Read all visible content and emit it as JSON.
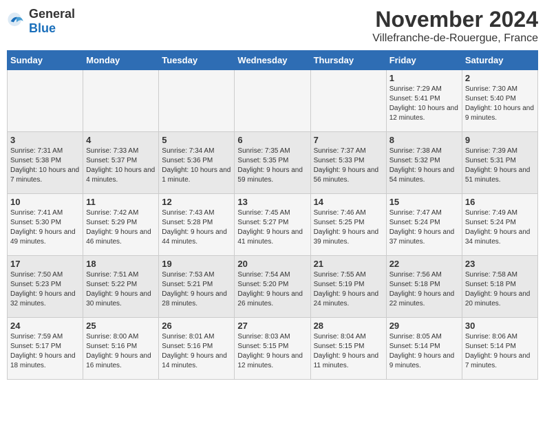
{
  "logo": {
    "general": "General",
    "blue": "Blue"
  },
  "title": "November 2024",
  "subtitle": "Villefranche-de-Rouergue, France",
  "headers": [
    "Sunday",
    "Monday",
    "Tuesday",
    "Wednesday",
    "Thursday",
    "Friday",
    "Saturday"
  ],
  "weeks": [
    [
      {
        "day": "",
        "info": ""
      },
      {
        "day": "",
        "info": ""
      },
      {
        "day": "",
        "info": ""
      },
      {
        "day": "",
        "info": ""
      },
      {
        "day": "",
        "info": ""
      },
      {
        "day": "1",
        "info": "Sunrise: 7:29 AM\nSunset: 5:41 PM\nDaylight: 10 hours and 12 minutes."
      },
      {
        "day": "2",
        "info": "Sunrise: 7:30 AM\nSunset: 5:40 PM\nDaylight: 10 hours and 9 minutes."
      }
    ],
    [
      {
        "day": "3",
        "info": "Sunrise: 7:31 AM\nSunset: 5:38 PM\nDaylight: 10 hours and 7 minutes."
      },
      {
        "day": "4",
        "info": "Sunrise: 7:33 AM\nSunset: 5:37 PM\nDaylight: 10 hours and 4 minutes."
      },
      {
        "day": "5",
        "info": "Sunrise: 7:34 AM\nSunset: 5:36 PM\nDaylight: 10 hours and 1 minute."
      },
      {
        "day": "6",
        "info": "Sunrise: 7:35 AM\nSunset: 5:35 PM\nDaylight: 9 hours and 59 minutes."
      },
      {
        "day": "7",
        "info": "Sunrise: 7:37 AM\nSunset: 5:33 PM\nDaylight: 9 hours and 56 minutes."
      },
      {
        "day": "8",
        "info": "Sunrise: 7:38 AM\nSunset: 5:32 PM\nDaylight: 9 hours and 54 minutes."
      },
      {
        "day": "9",
        "info": "Sunrise: 7:39 AM\nSunset: 5:31 PM\nDaylight: 9 hours and 51 minutes."
      }
    ],
    [
      {
        "day": "10",
        "info": "Sunrise: 7:41 AM\nSunset: 5:30 PM\nDaylight: 9 hours and 49 minutes."
      },
      {
        "day": "11",
        "info": "Sunrise: 7:42 AM\nSunset: 5:29 PM\nDaylight: 9 hours and 46 minutes."
      },
      {
        "day": "12",
        "info": "Sunrise: 7:43 AM\nSunset: 5:28 PM\nDaylight: 9 hours and 44 minutes."
      },
      {
        "day": "13",
        "info": "Sunrise: 7:45 AM\nSunset: 5:27 PM\nDaylight: 9 hours and 41 minutes."
      },
      {
        "day": "14",
        "info": "Sunrise: 7:46 AM\nSunset: 5:25 PM\nDaylight: 9 hours and 39 minutes."
      },
      {
        "day": "15",
        "info": "Sunrise: 7:47 AM\nSunset: 5:24 PM\nDaylight: 9 hours and 37 minutes."
      },
      {
        "day": "16",
        "info": "Sunrise: 7:49 AM\nSunset: 5:24 PM\nDaylight: 9 hours and 34 minutes."
      }
    ],
    [
      {
        "day": "17",
        "info": "Sunrise: 7:50 AM\nSunset: 5:23 PM\nDaylight: 9 hours and 32 minutes."
      },
      {
        "day": "18",
        "info": "Sunrise: 7:51 AM\nSunset: 5:22 PM\nDaylight: 9 hours and 30 minutes."
      },
      {
        "day": "19",
        "info": "Sunrise: 7:53 AM\nSunset: 5:21 PM\nDaylight: 9 hours and 28 minutes."
      },
      {
        "day": "20",
        "info": "Sunrise: 7:54 AM\nSunset: 5:20 PM\nDaylight: 9 hours and 26 minutes."
      },
      {
        "day": "21",
        "info": "Sunrise: 7:55 AM\nSunset: 5:19 PM\nDaylight: 9 hours and 24 minutes."
      },
      {
        "day": "22",
        "info": "Sunrise: 7:56 AM\nSunset: 5:18 PM\nDaylight: 9 hours and 22 minutes."
      },
      {
        "day": "23",
        "info": "Sunrise: 7:58 AM\nSunset: 5:18 PM\nDaylight: 9 hours and 20 minutes."
      }
    ],
    [
      {
        "day": "24",
        "info": "Sunrise: 7:59 AM\nSunset: 5:17 PM\nDaylight: 9 hours and 18 minutes."
      },
      {
        "day": "25",
        "info": "Sunrise: 8:00 AM\nSunset: 5:16 PM\nDaylight: 9 hours and 16 minutes."
      },
      {
        "day": "26",
        "info": "Sunrise: 8:01 AM\nSunset: 5:16 PM\nDaylight: 9 hours and 14 minutes."
      },
      {
        "day": "27",
        "info": "Sunrise: 8:03 AM\nSunset: 5:15 PM\nDaylight: 9 hours and 12 minutes."
      },
      {
        "day": "28",
        "info": "Sunrise: 8:04 AM\nSunset: 5:15 PM\nDaylight: 9 hours and 11 minutes."
      },
      {
        "day": "29",
        "info": "Sunrise: 8:05 AM\nSunset: 5:14 PM\nDaylight: 9 hours and 9 minutes."
      },
      {
        "day": "30",
        "info": "Sunrise: 8:06 AM\nSunset: 5:14 PM\nDaylight: 9 hours and 7 minutes."
      }
    ]
  ]
}
